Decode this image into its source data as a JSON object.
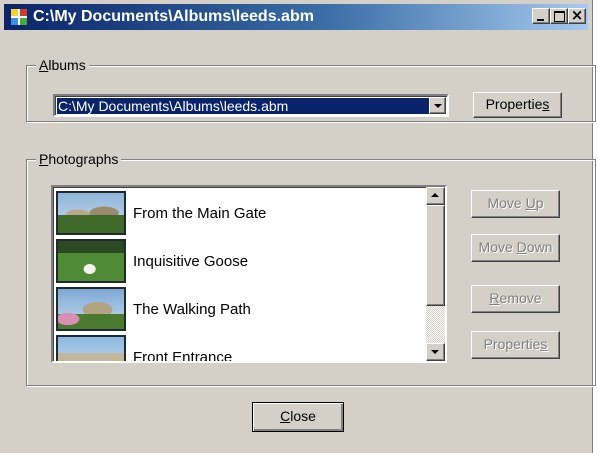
{
  "window": {
    "title": "C:\\My Documents\\Albums\\leeds.abm",
    "icon": "album-app-icon",
    "controls": [
      "minimize-icon",
      "maximize-icon",
      "close-icon"
    ]
  },
  "albums": {
    "group_label_accel": "A",
    "group_label_rest": "lbums",
    "selected_path": "C:\\My Documents\\Albums\\leeds.abm",
    "properties_pre": "Propertie",
    "properties_accel": "s",
    "properties_post": ""
  },
  "photographs": {
    "group_label_accel": "P",
    "group_label_rest": "hotographs",
    "items": [
      {
        "label": "From the Main Gate"
      },
      {
        "label": "Inquisitive Goose"
      },
      {
        "label": "The Walking Path"
      },
      {
        "label": "Front Entrance"
      }
    ],
    "buttons": {
      "move_up_pre": "Move ",
      "move_up_accel": "U",
      "move_up_post": "p",
      "move_down_pre": "Move ",
      "move_down_accel": "D",
      "move_down_post": "own",
      "remove_pre": "",
      "remove_accel": "R",
      "remove_post": "emove",
      "properties_pre": "Propertie",
      "properties_accel": "s",
      "properties_post": ""
    }
  },
  "footer": {
    "close_accel": "C",
    "close_post": "lose"
  },
  "colors": {
    "dialog_face": "#d4d0c8",
    "title_start": "#0a246a",
    "title_end": "#a6caf0",
    "selection": "#0a246a"
  }
}
